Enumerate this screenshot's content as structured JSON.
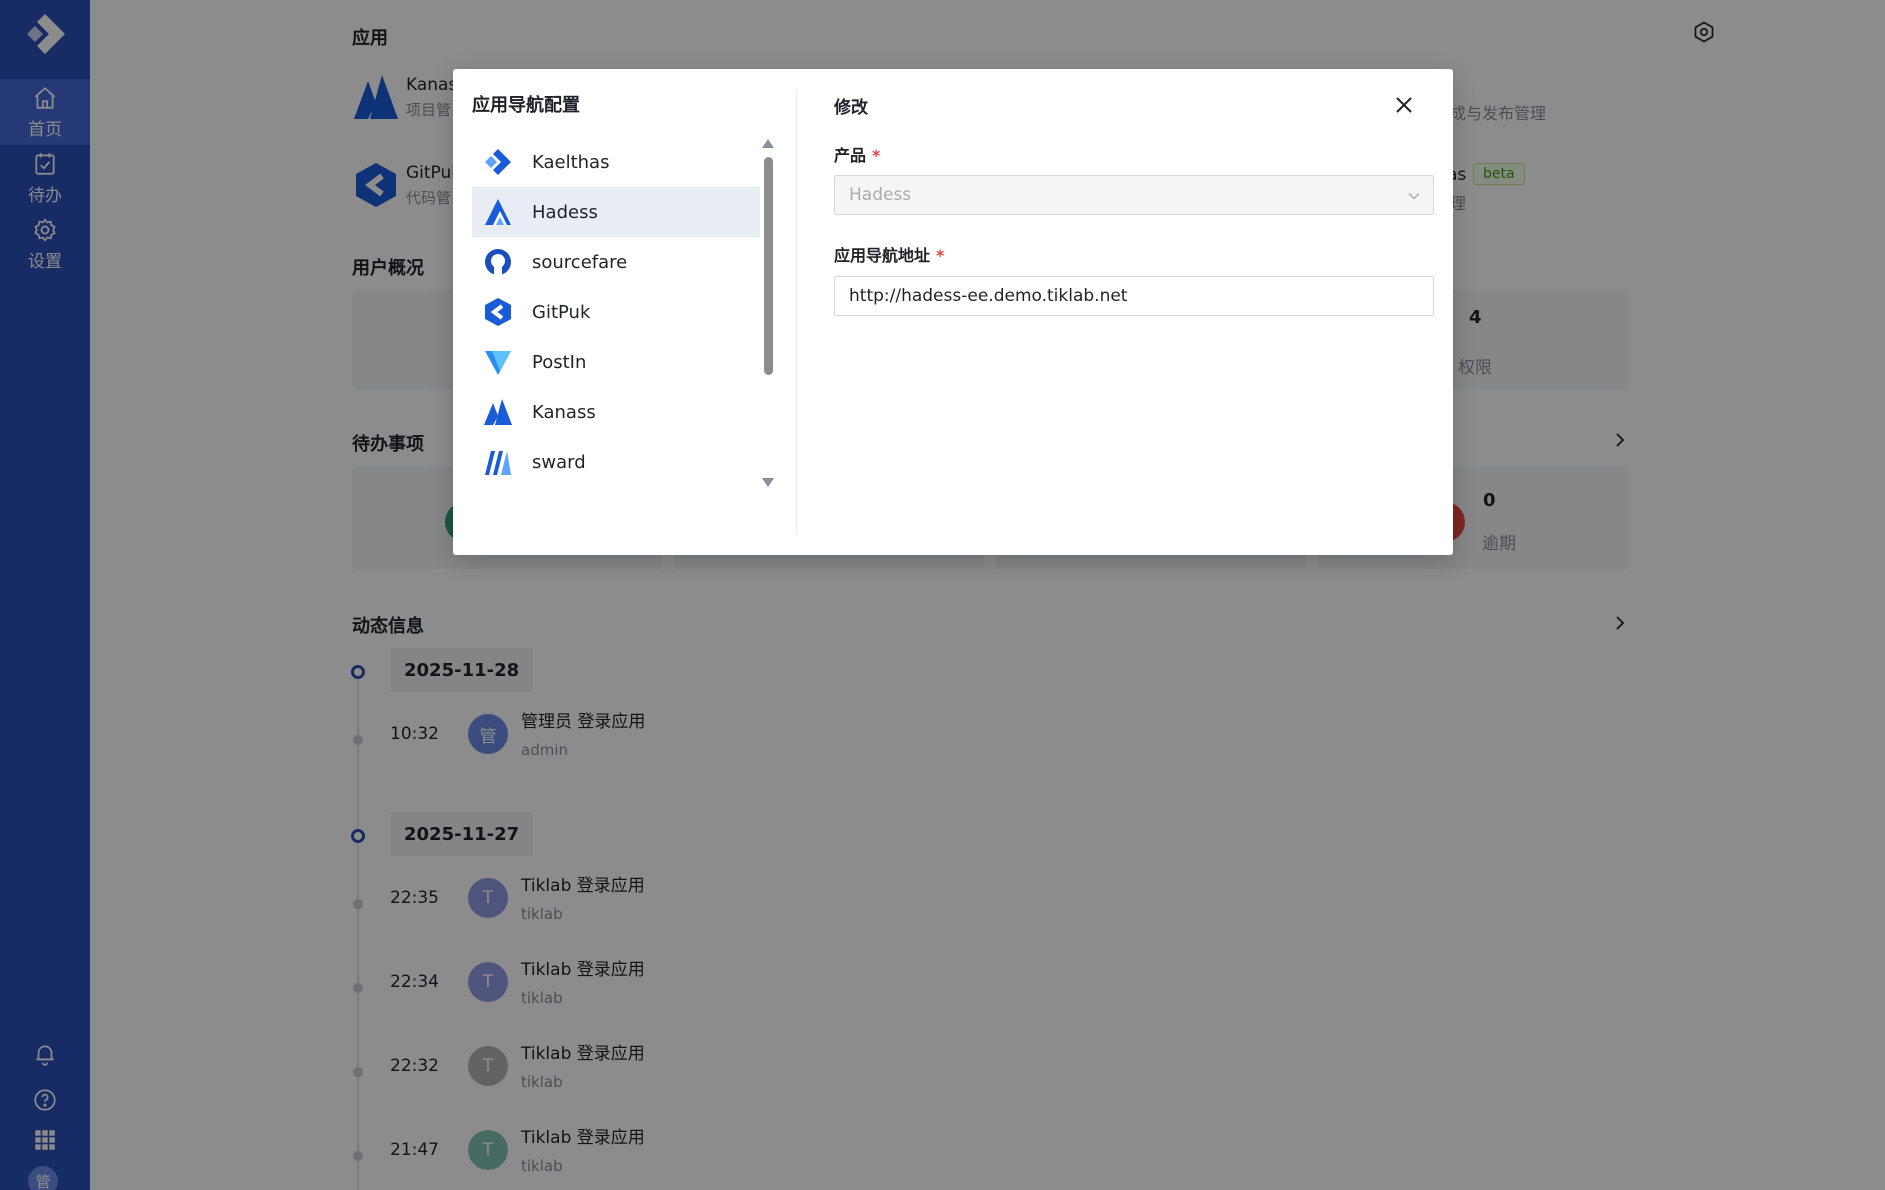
{
  "sidebar": {
    "nav": [
      {
        "label": "首页",
        "icon": "home-icon",
        "active": true
      },
      {
        "label": "待办",
        "icon": "todo-icon",
        "active": false
      },
      {
        "label": "设置",
        "icon": "gear-icon",
        "active": false
      }
    ],
    "avatar_text": "管"
  },
  "main": {
    "apps_title": "应用",
    "apps": [
      {
        "name": "Kanas",
        "desc": "项目管"
      },
      {
        "name": "GitPul",
        "desc": "代码管"
      }
    ],
    "apps_right": {
      "desc1": "成与发布管理",
      "desc2": "理",
      "name2_tail": "as",
      "beta": "beta"
    },
    "overview_title": "用户概况",
    "overview_right": {
      "value": "4",
      "label": "权限"
    },
    "todo_title": "待办事项",
    "todo_right": {
      "value": "0",
      "label": "逾期"
    },
    "activity_title": "动态信息",
    "timeline": [
      {
        "date": "2025-11-28",
        "entries": [
          {
            "time": "10:32",
            "avatar": "管",
            "text": "管理员 登录应用",
            "sub": "admin",
            "color": "#6b8ce6"
          }
        ]
      },
      {
        "date": "2025-11-27",
        "entries": [
          {
            "time": "22:35",
            "avatar": "T",
            "text": "Tiklab 登录应用",
            "sub": "tiklab",
            "color": "#8e9ae0"
          },
          {
            "time": "22:34",
            "avatar": "T",
            "text": "Tiklab 登录应用",
            "sub": "tiklab",
            "color": "#8e9ae0"
          },
          {
            "time": "22:32",
            "avatar": "T",
            "text": "Tiklab 登录应用",
            "sub": "tiklab",
            "color": "#b5b5b5"
          },
          {
            "time": "21:47",
            "avatar": "T",
            "text": "Tiklab 登录应用",
            "sub": "tiklab",
            "color": "#7fc4b4"
          }
        ]
      }
    ]
  },
  "modal": {
    "title": "应用导航配置",
    "products": [
      {
        "label": "Kaelthas",
        "icon": "kaelthas-logo-icon"
      },
      {
        "label": "Hadess",
        "icon": "hadess-logo-icon"
      },
      {
        "label": "sourcefare",
        "icon": "sourcefare-logo-icon"
      },
      {
        "label": "GitPuk",
        "icon": "gitpuk-logo-icon"
      },
      {
        "label": "PostIn",
        "icon": "postin-logo-icon"
      },
      {
        "label": "Kanass",
        "icon": "kanass-logo-icon"
      },
      {
        "label": "sward",
        "icon": "sward-logo-icon"
      }
    ],
    "selected_index": 1,
    "edit_title": "修改",
    "product_label": "产品",
    "product_value": "Hadess",
    "url_label": "应用导航地址",
    "url_value": "http://hadess-ee.demo.tiklab.net",
    "required_mark": "*"
  },
  "colors": {
    "sidebar": "#2a4fb8",
    "brand_blue": "#1a5bd8",
    "required": "#e54545",
    "selected_row": "#e8ecf4"
  }
}
